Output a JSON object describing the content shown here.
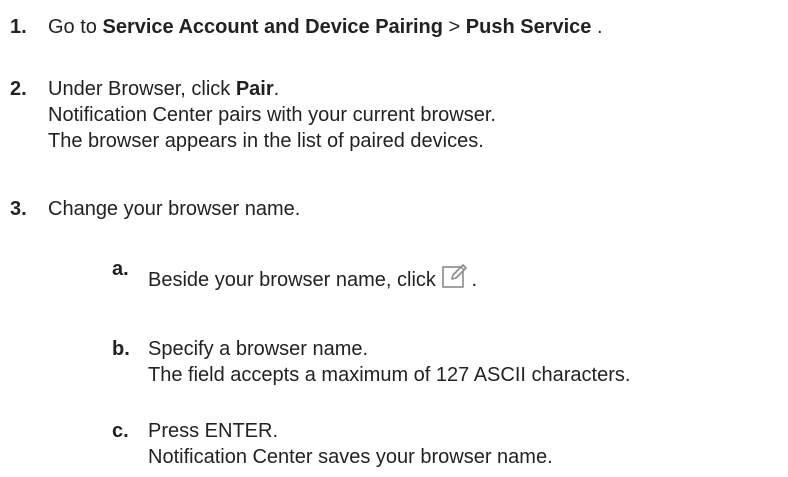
{
  "steps": [
    {
      "number": "1.",
      "pre": "Go to ",
      "bold1": "Service Account and Device Pairing",
      "mid": " > ",
      "bold2": "Push Service",
      "post": " ."
    },
    {
      "number": "2.",
      "pre": "Under Browser, click ",
      "bold": "Pair",
      "post": ".",
      "result1": "Notification Center pairs with your current browser.",
      "result2": "The browser appears in the list of paired devices."
    },
    {
      "number": "3.",
      "text": "Change your browser name.",
      "substeps": [
        {
          "number": "a.",
          "text": "Beside your browser name, click ",
          "icon": "edit-icon",
          "post": "."
        },
        {
          "number": "b.",
          "text": "Specify a browser name.",
          "result": "The field accepts a maximum of 127 ASCII characters."
        },
        {
          "number": "c.",
          "text": "Press ENTER.",
          "result": "Notification Center saves your browser name."
        }
      ]
    }
  ]
}
